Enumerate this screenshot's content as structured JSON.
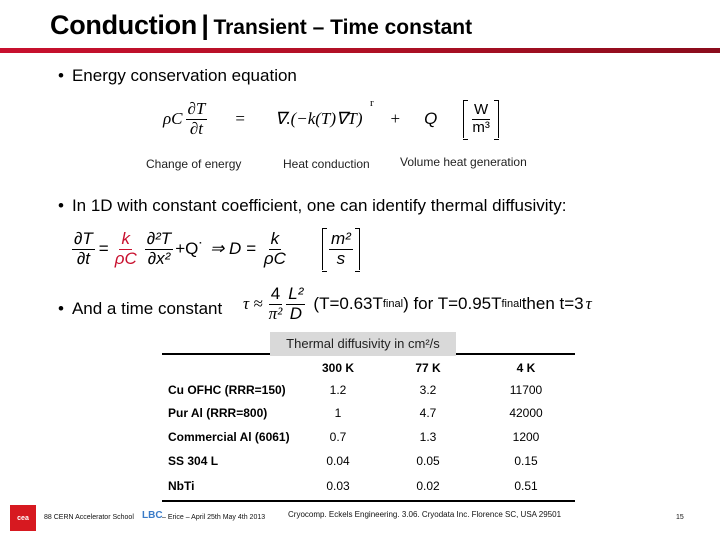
{
  "slide": {
    "title_main": "Conduction",
    "title_separator": "|",
    "title_sub": "Transient – Time constant",
    "accent_color": "#c8102e",
    "bullet_glyph": "•",
    "bullets": [
      "Energy conservation equation",
      "In 1D with constant coefficient, one can identify thermal diffusivity:",
      "And a time constant"
    ],
    "equation1": {
      "lhs_prefix": "ρC",
      "lhs_num": "∂T",
      "lhs_den": "∂t",
      "equals": "=",
      "conduction_term": "∇.(−k(T)∇T)",
      "vector_mark": "r",
      "plus": "+",
      "source": "Q",
      "unit_num": "W",
      "unit_den": "m³",
      "captions": [
        "Change of energy",
        "Heat conduction",
        "Volume heat generation"
      ]
    },
    "equation2": {
      "lhs_num": "∂T",
      "lhs_den": "∂t",
      "equals": "=",
      "coef_num": "k",
      "coef_den": "ρC",
      "deriv_num": "∂²T",
      "deriv_den": "∂x²",
      "plus_q": "+Q˙",
      "implies": "⇒ D =",
      "d_num": "k",
      "d_den": "ρC",
      "unit_num": "m²",
      "unit_den": "s"
    },
    "equation3": {
      "tau": "τ ≈",
      "num1": "4",
      "den1": "π²",
      "num2": "L²",
      "den2": "D",
      "text_a": "(T=0.63T",
      "sub_a": "final",
      "text_b": ") for T=0.95T",
      "sub_b": "final",
      "text_c": " then t=3",
      "tau_end": "τ"
    },
    "table": {
      "label": "Thermal diffusivity in cm²/s",
      "columns": [
        "300 K",
        "77 K",
        "4 K"
      ],
      "rows": [
        {
          "material": "Cu OFHC (RRR=150)",
          "values": [
            "1.2",
            "3.2",
            "11700"
          ]
        },
        {
          "material": "Pur Al (RRR=800)",
          "values": [
            "1",
            "4.7",
            "42000"
          ]
        },
        {
          "material": "Commercial Al (6061)",
          "values": [
            "0.7",
            "1.3",
            "1200"
          ]
        },
        {
          "material": "SS 304 L",
          "values": [
            "0.04",
            "0.05",
            "0.15"
          ]
        },
        {
          "material": "NbTi",
          "values": [
            "0.03",
            "0.02",
            "0.51"
          ]
        }
      ]
    },
    "footer": {
      "logo_text": "cea",
      "left_text": "88  CERN Accelerator School",
      "lbc_logo": "LBC",
      "event_text": "– Erice – April 25th  May 4th 2013",
      "reference": "Cryocomp. Eckels Engineering. 3.06. Cryodata Inc. Florence SC, USA 29501",
      "page_number": "15"
    }
  }
}
